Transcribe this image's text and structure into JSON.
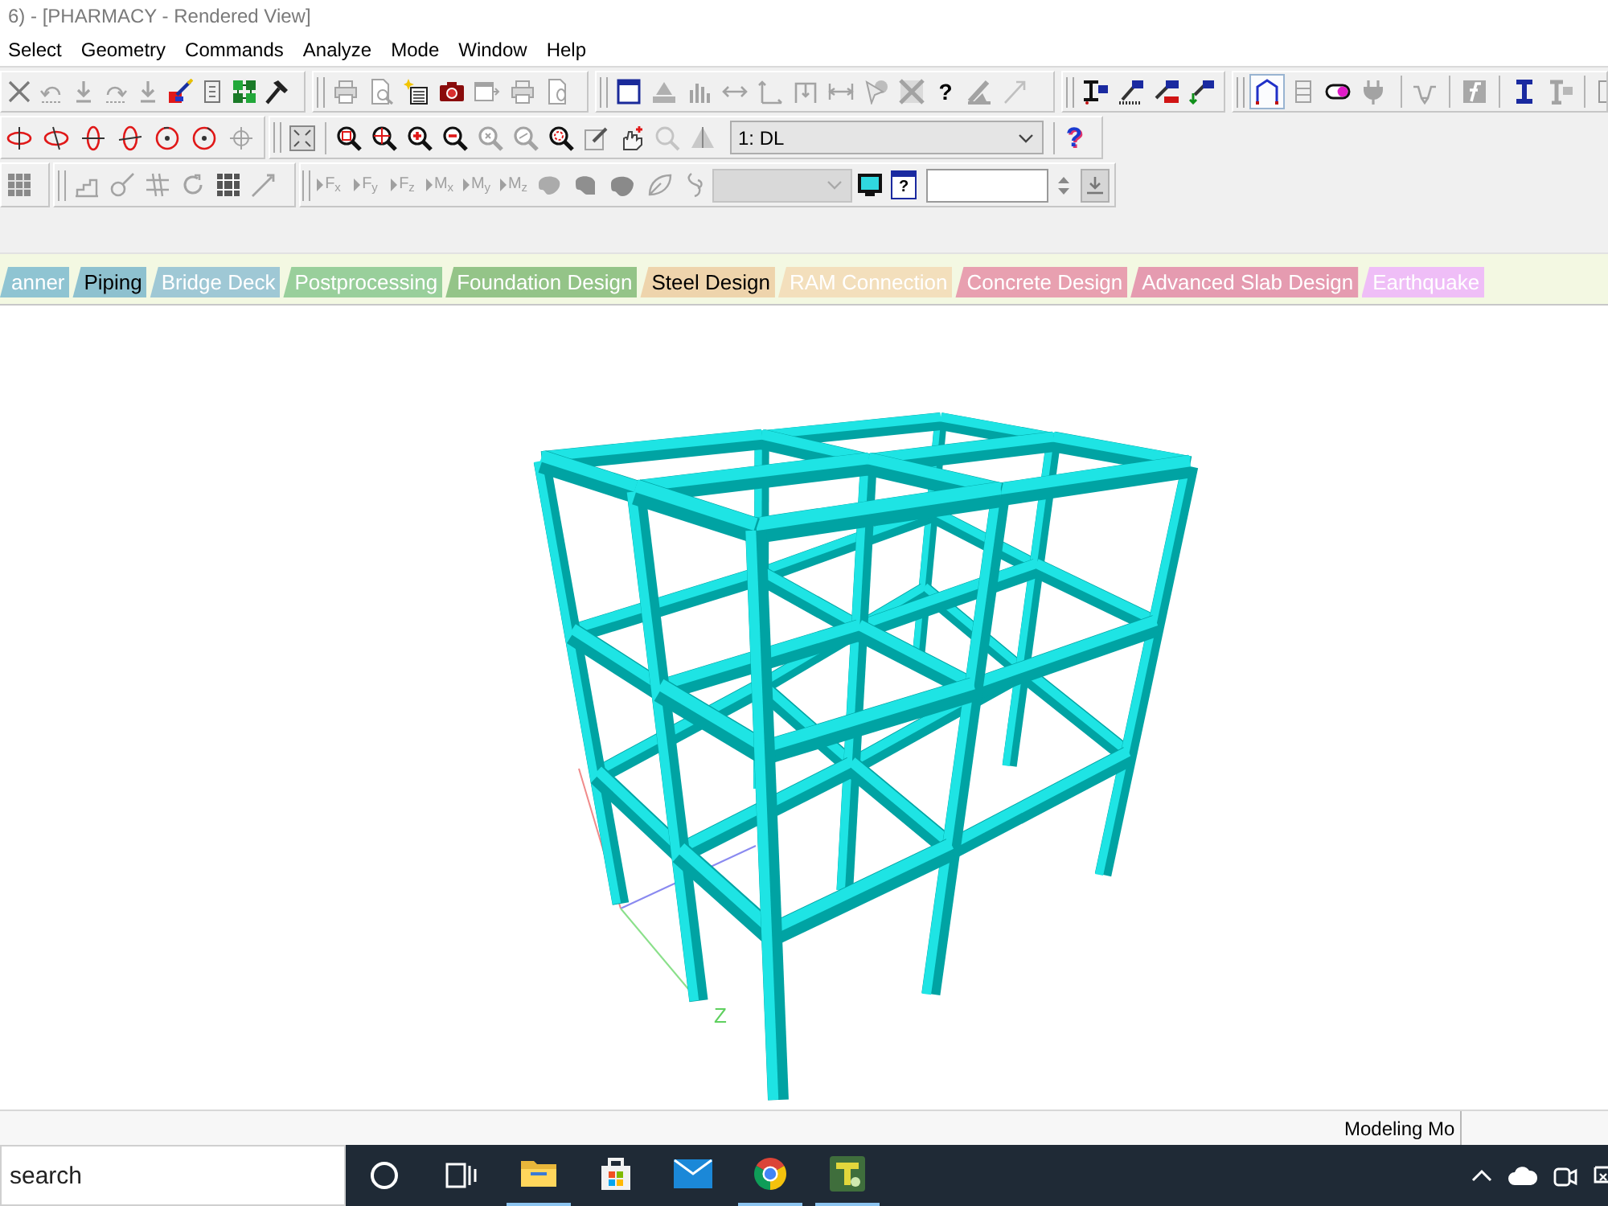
{
  "window": {
    "title": "6) - [PHARMACY - Rendered View]"
  },
  "menu": [
    "Select",
    "Geometry",
    "Commands",
    "Analyze",
    "Mode",
    "Window",
    "Help"
  ],
  "toolbars": {
    "help_button": {
      "label": "?",
      "disabled": false
    },
    "structure_toggles": [
      {
        "selected": true
      },
      {
        "selected": false
      },
      {
        "selected": false
      },
      {
        "selected": false
      }
    ],
    "view_help_button": {
      "label": "?"
    },
    "load_case_select": {
      "value": "1: DL"
    },
    "load_buttons": [
      {
        "label": "F$_{x}$",
        "disabled": true
      },
      {
        "label": "F$_{y}$",
        "disabled": true
      },
      {
        "label": "F$_{z}$",
        "disabled": true
      },
      {
        "label": "M$_{x}$",
        "disabled": true
      },
      {
        "label": "M$_{y}$",
        "disabled": true
      },
      {
        "label": "M$_{z}$",
        "disabled": true
      }
    ],
    "load_help_button": {
      "label": "?"
    }
  },
  "workflow_tabs": [
    {
      "label": "anner",
      "color": "#8fc4d2",
      "active": false
    },
    {
      "label": "Piping",
      "color": "#8ec1cf",
      "active": true
    },
    {
      "label": "Bridge Deck",
      "color": "#9fc8d5",
      "active": false
    },
    {
      "label": "Postprocessing",
      "color": "#99cf9b",
      "active": false
    },
    {
      "label": "Foundation Design",
      "color": "#94c488",
      "active": false
    },
    {
      "label": "Steel Design",
      "color": "#eed4ac",
      "active": true
    },
    {
      "label": "RAM Connection",
      "color": "#f3dfbc",
      "active": false
    },
    {
      "label": "Concrete Design",
      "color": "#e8a0b0",
      "active": false
    },
    {
      "label": "Advanced Slab Design",
      "color": "#e59bb0",
      "active": false
    },
    {
      "label": "Earthquake",
      "color": "#efbef7",
      "active": false
    }
  ],
  "viewport": {
    "axis_label": "Z"
  },
  "status_bar": {
    "mode": "Modeling Mo"
  },
  "taskbar": {
    "search": {
      "placeholder": "search"
    },
    "pinned_apps": [
      {
        "running": true
      },
      {
        "running": false
      },
      {
        "running": false
      },
      {
        "running": true
      },
      {
        "running": true
      }
    ]
  }
}
